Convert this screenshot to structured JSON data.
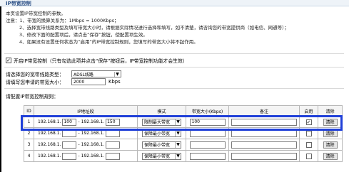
{
  "header": {
    "title": "IP带宽控制"
  },
  "intro": {
    "line1": "本页设置IP带宽控制的参数。",
    "note_label": "注意：",
    "notes": [
      "1、带宽的换算关系为：1Mbps = 1000Kbps；",
      "2、选择宽带线路类型及填写带宽大小时，请根据实际情况进行选择和填写，如不清楚，请咨询您的带宽提供商（如电信、网通等）；",
      "3、修改下面的配置项后，请点击“保存”按钮，使配置项生效。",
      "4、如果没有设置任何状态为“启用”的IP带宽控制规则，您填写的带宽大小将不起作用。"
    ]
  },
  "enable": {
    "checked": true,
    "check_glyph": "✓",
    "label": "开启IP带宽控制（只有勾选此项并点击“保存”按钮后，IP带宽控制功能才会生效）"
  },
  "bandwidth_type": {
    "label": "请选择您的宽带线路类型：",
    "value": "ADSL线路"
  },
  "bandwidth_total": {
    "label": "请填写您申请的带宽大小：",
    "value": "2000",
    "unit": "Kbps"
  },
  "rules_label": "请配置IP带宽控制规则：",
  "table": {
    "headers": [
      "ID",
      "IP地址段",
      "模式",
      "带宽大小(Kbps)",
      "备注",
      "启用",
      "清除"
    ],
    "rows": [
      {
        "id": "1",
        "ip_prefix_start": "192.168.1.",
        "ip_start": "100",
        "sep": "-",
        "ip_prefix_end": "192.168.1.",
        "ip_end": "150",
        "mode": "限制最大带宽",
        "bandwidth": "100",
        "note": "",
        "enabled": true,
        "clear": "清除"
      },
      {
        "id": "2",
        "ip_prefix_start": "192.168.1.",
        "ip_start": "",
        "sep": "-",
        "ip_prefix_end": "192.168.1.",
        "ip_end": "",
        "mode": "保障最小带宽",
        "bandwidth": "",
        "note": "",
        "enabled": false,
        "clear": "清除"
      },
      {
        "id": "3",
        "ip_prefix_start": "192.168.1.",
        "ip_start": "",
        "sep": "-",
        "ip_prefix_end": "192.168.1.",
        "ip_end": "",
        "mode": "保障最小带宽",
        "bandwidth": "",
        "note": "",
        "enabled": false,
        "clear": "清除"
      },
      {
        "id": "4",
        "ip_prefix_start": "192.168.1.",
        "ip_start": "",
        "sep": "-",
        "ip_prefix_end": "192.168.1.",
        "ip_end": "",
        "mode": "保障最小带宽",
        "bandwidth": "",
        "note": "",
        "enabled": false,
        "clear": "清除"
      }
    ]
  },
  "colors": {
    "highlight": "#1f3fd8",
    "title_text": "#2b4f86"
  },
  "icons": {
    "select_arrow": "chevron-down-icon",
    "checkbox": "checkmark-icon"
  }
}
